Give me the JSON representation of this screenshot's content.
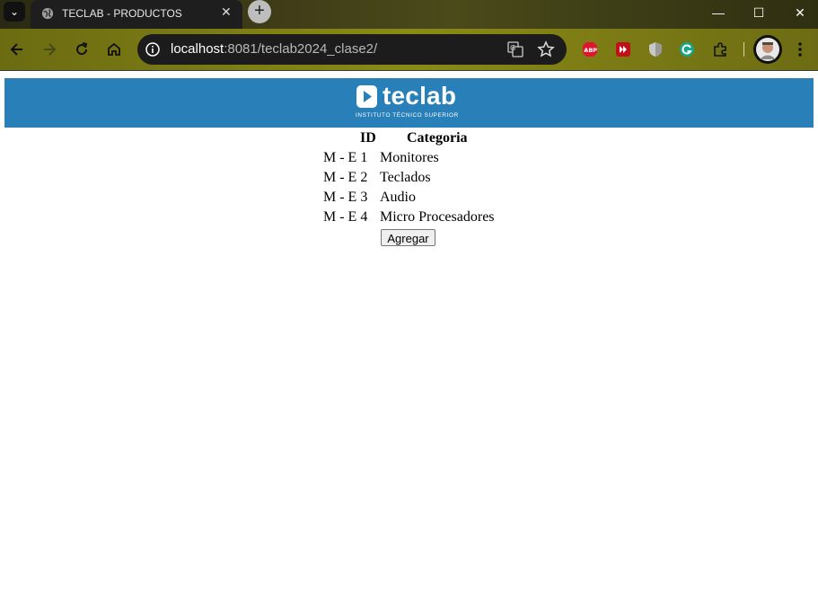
{
  "browser": {
    "tab_title": "TECLAB - PRODUCTOS",
    "url_host": "localhost",
    "url_rest": ":8081/teclab2024_clase2/",
    "extensions": [
      "adblock-plus-icon",
      "red-extension-icon",
      "shield-extension-icon",
      "grammarly-icon",
      "puzzle-icon"
    ]
  },
  "header": {
    "logo_text": "teclab",
    "logo_subtitle": "INSTITUTO TÉCNICO SUPERIOR",
    "background_color": "#2980b9"
  },
  "table": {
    "headers": [
      "ID",
      "Categoria"
    ],
    "rows": [
      {
        "id": "M - E 1",
        "categoria": "Monitores"
      },
      {
        "id": "M - E 2",
        "categoria": "Teclados"
      },
      {
        "id": "M - E 3",
        "categoria": "Audio"
      },
      {
        "id": "M - E 4",
        "categoria": "Micro Procesadores"
      }
    ],
    "add_button_label": "Agregar"
  }
}
